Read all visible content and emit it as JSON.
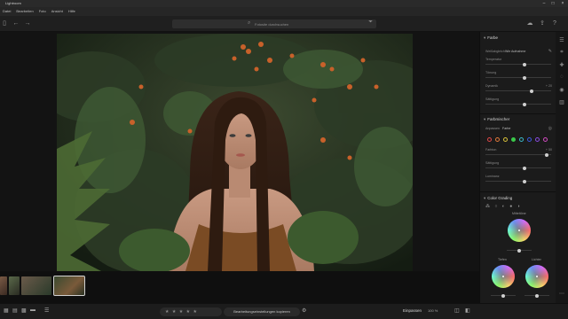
{
  "window": {
    "title": "Lightroom"
  },
  "menu": [
    "Datei",
    "Bearbeiten",
    "Foto",
    "Ansicht",
    "Hilfe"
  ],
  "toolbar": {
    "search_placeholder": "Fotosite durchsuchen"
  },
  "filmstrip": {
    "thumbnail_count": 4,
    "active_index": 3
  },
  "bottombar": {
    "rating_label": "★ ★ ★ ★ ★",
    "copy_settings_label": "Bearbeitungseinstellungen kopieren",
    "fit_label": "Einpassen",
    "zoom_label": "100 %"
  },
  "panel": {
    "farbe": {
      "title": "Farbe",
      "wb_label": "Weißabgleich",
      "wb_value": "Wie Aufnahme",
      "sliders": [
        {
          "label": "Temperatur",
          "value": "",
          "pos": 0.6
        },
        {
          "label": "Tönung",
          "value": "",
          "pos": 0.6
        },
        {
          "label": "Dynamik",
          "value": "+ 20",
          "pos": 0.72
        },
        {
          "label": "Sättigung",
          "value": "",
          "pos": 0.6
        }
      ]
    },
    "mixer": {
      "title": "Farbmischer",
      "anpassen_label": "Anpassen",
      "anpassen_value": "Farbe",
      "swatch_colors": [
        "#e04848",
        "#e07a3a",
        "#d8c23a",
        "#3ac84a",
        "#3ab8c8",
        "#3a5ae0",
        "#8a4ae0",
        "#d04ac0"
      ],
      "active_swatch": 3,
      "sliders": [
        {
          "label": "Farbton",
          "value": "+ 50",
          "pos": 0.95
        },
        {
          "label": "Sättigung",
          "value": "",
          "pos": 0.6
        },
        {
          "label": "Luminanz",
          "value": "",
          "pos": 0.6
        }
      ]
    },
    "grading": {
      "title": "Color Grading",
      "wheel_labels": {
        "mid": "Mitteltöne",
        "shadows": "Tiefen",
        "highlights": "Lichter"
      }
    }
  },
  "colors": {
    "accent": "#4aa3ff",
    "panel_bg": "#1b1b1b",
    "canvas_bg": "#131313"
  }
}
